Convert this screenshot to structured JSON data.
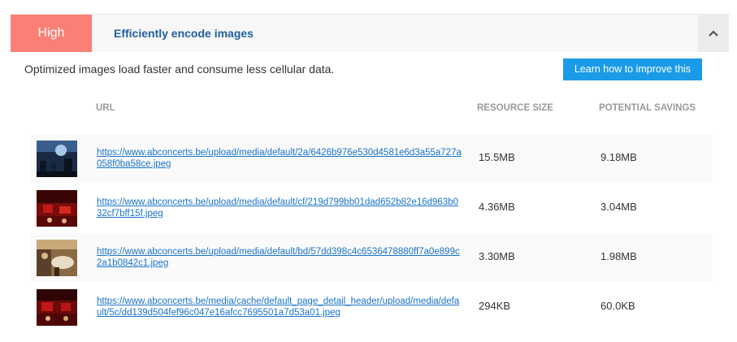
{
  "audit": {
    "severity": "High",
    "title": "Efficiently encode images",
    "description": "Optimized images load faster and consume less cellular data.",
    "learn_button": "Learn how to improve this",
    "toggle_icon": "chevron-up-icon",
    "colors": {
      "severity_bg": "#fa7f76",
      "title": "#1f5f9e",
      "button_bg": "#1a9be8",
      "link": "#1a73c9"
    }
  },
  "table": {
    "columns": {
      "url": "URL",
      "size": "RESOURCE SIZE",
      "savings": "POTENTIAL SAVINGS"
    },
    "rows": [
      {
        "url": "https://www.abconcerts.be/upload/media/default/2a/6426b976e530d4581e6d3a55a727a058f0ba58ce.jpeg",
        "size": "15.5MB",
        "savings": "9.18MB",
        "thumb": "concert-stage-thumbnail"
      },
      {
        "url": "https://www.abconcerts.be/upload/media/default/cf/219d799bb01dad652b82e16d963b032cf7bff15f.jpeg",
        "size": "4.36MB",
        "savings": "3.04MB",
        "thumb": "red-hall-thumbnail"
      },
      {
        "url": "https://www.abconcerts.be/upload/media/default/bd/57dd398c4c6536478880ff7a0e899c2a1b0842c1.jpeg",
        "size": "3.30MB",
        "savings": "1.98MB",
        "thumb": "restaurant-table-thumbnail"
      },
      {
        "url": "https://www.abconcerts.be/media/cache/default_page_detail_header/upload/media/default/5c/dd139d504fef96c047e16afcc7695501a7d53a01.jpeg",
        "size": "294KB",
        "savings": "60.0KB",
        "thumb": "red-hall-thumbnail"
      }
    ]
  }
}
